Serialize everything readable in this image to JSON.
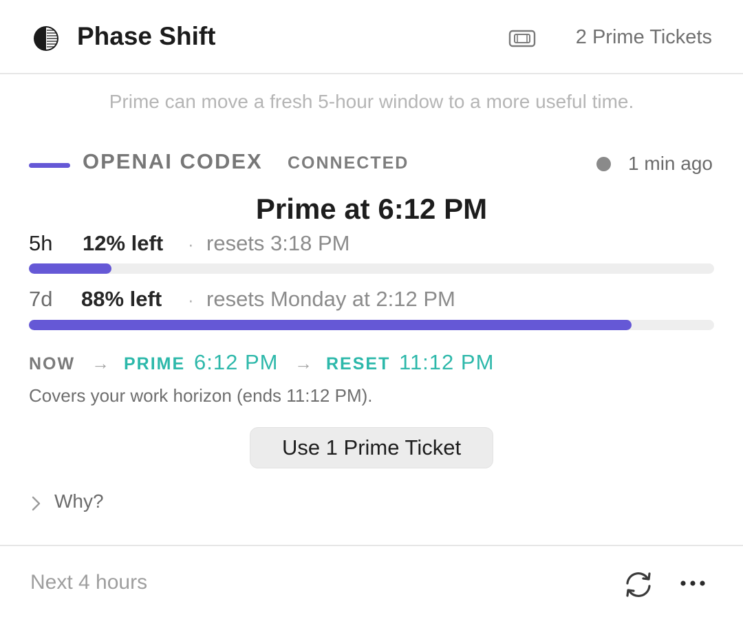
{
  "header": {
    "app_icon": "half-moon-icon",
    "title": "Phase Shift",
    "ticket_icon": "ticket-icon",
    "tickets_label": "2 Prime Tickets"
  },
  "subtitle": "Prime can move a fresh 5-hour window to a more useful time.",
  "provider": {
    "name": "OPENAI CODEX",
    "status": "CONNECTED",
    "updated": "1 min ago",
    "accent_color": "#6558d6"
  },
  "prime_heading": "Prime at 6:12 PM",
  "limits": [
    {
      "label": "5h",
      "percent_label": "12% left",
      "separator": "·",
      "reset_label": "resets 3:18 PM",
      "remaining_percent": 12
    },
    {
      "label": "7d",
      "percent_label": "88% left",
      "separator": "·",
      "reset_label": "resets Monday at 2:12 PM",
      "remaining_percent": 88
    }
  ],
  "timeline": {
    "now_label": "NOW",
    "arrow": "→",
    "prime_label": "PRIME",
    "prime_time": "6:12 PM",
    "reset_label": "RESET",
    "reset_time": "11:12 PM",
    "highlight_color": "#2db8aa"
  },
  "covers_text": "Covers your work horizon (ends 11:12 PM).",
  "action_button": "Use 1 Prime Ticket",
  "why_label": "Why?",
  "footer": {
    "label": "Next 4 hours",
    "refresh_icon": "refresh-icon",
    "more_icon": "more-dots-icon"
  }
}
